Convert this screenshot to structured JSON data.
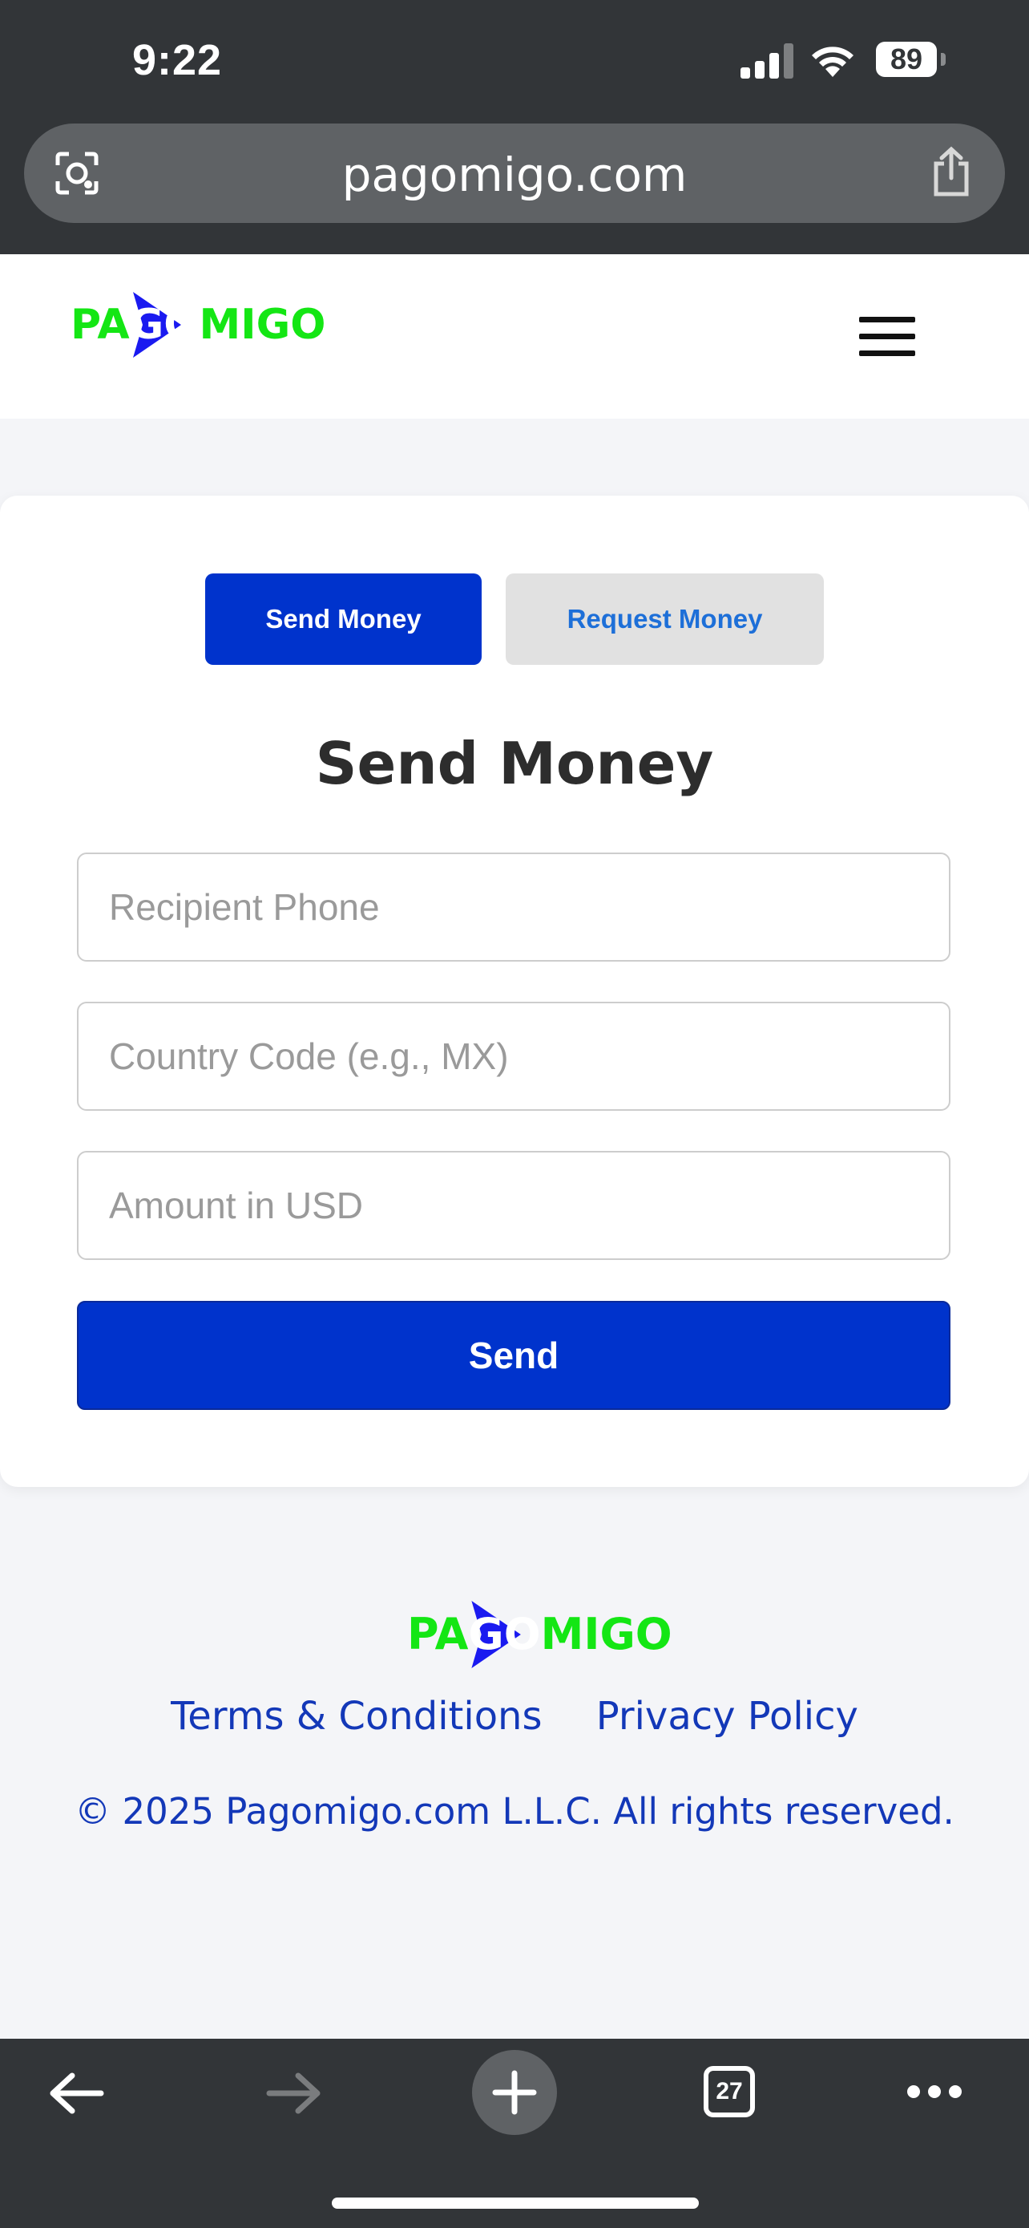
{
  "status_bar": {
    "time": "9:22",
    "battery": "89"
  },
  "browser": {
    "url": "pagomigo.com",
    "tab_count": "27"
  },
  "logo": {
    "left": "PA",
    "middle": "GO",
    "right": "MIGO"
  },
  "tabs": {
    "send_label": "Send Money",
    "request_label": "Request Money"
  },
  "form": {
    "title": "Send Money",
    "phone_placeholder": "Recipient Phone",
    "country_placeholder": "Country Code (e.g., MX)",
    "amount_placeholder": "Amount in USD",
    "send_label": "Send"
  },
  "footer": {
    "terms_label": "Terms & Conditions",
    "privacy_label": "Privacy Policy",
    "copyright": "© 2025 Pagomigo.com L.L.C. All rights reserved."
  },
  "colors": {
    "brand_green": "#14e614",
    "brand_blue": "#0033cc",
    "link_blue": "#1338b8",
    "chrome": "#323538"
  }
}
